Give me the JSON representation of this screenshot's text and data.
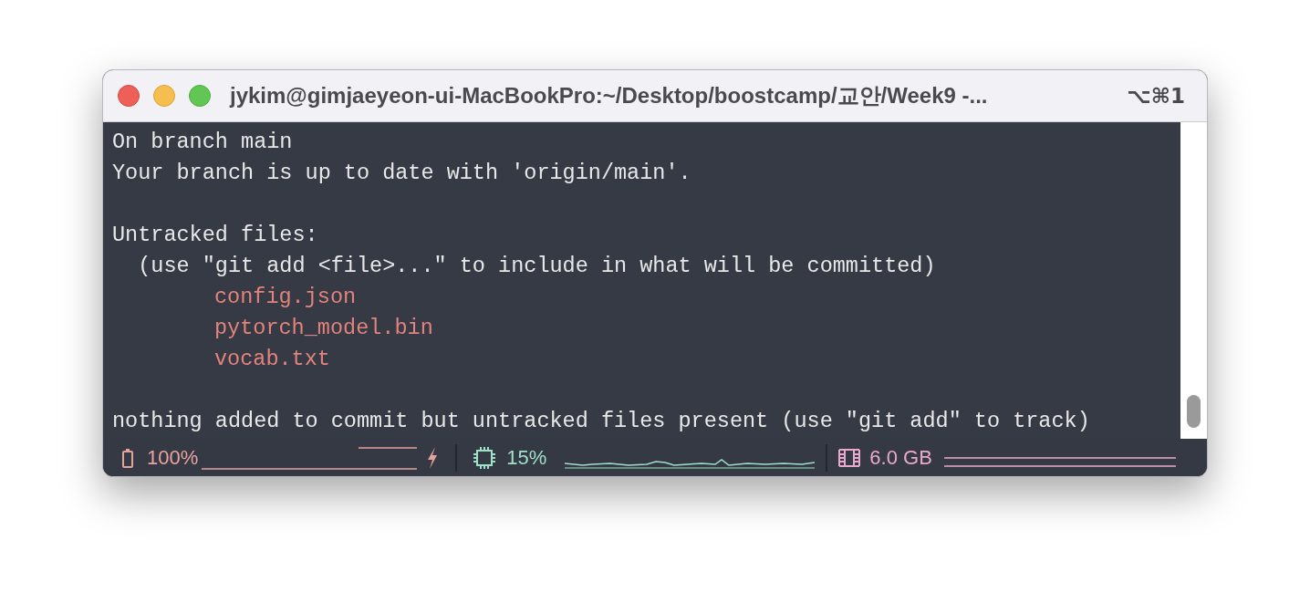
{
  "window": {
    "title": "jykim@gimjaeyeon-ui-MacBookPro:~/Desktop/boostcamp/교안/Week9 -...",
    "shortcut": "⌥⌘1"
  },
  "lines": [
    {
      "kind": "plain",
      "text": "On branch main"
    },
    {
      "kind": "plain",
      "text": "Your branch is up to date with 'origin/main'."
    },
    {
      "kind": "blank"
    },
    {
      "kind": "plain",
      "text": "Untracked files:"
    },
    {
      "kind": "plain",
      "text": "  (use \"git add <file>...\" to include in what will be committed)"
    },
    {
      "kind": "untracked",
      "text": "config.json"
    },
    {
      "kind": "untracked",
      "text": "pytorch_model.bin"
    },
    {
      "kind": "untracked",
      "text": "vocab.txt"
    },
    {
      "kind": "blank"
    },
    {
      "kind": "plain",
      "text": "nothing added to commit but untracked files present (use \"git add\" to track)"
    }
  ],
  "status_bar": {
    "battery": {
      "reading": "100%",
      "charging": true
    },
    "cpu": {
      "reading": "15%"
    },
    "memory": {
      "reading": "6.0 GB"
    }
  }
}
